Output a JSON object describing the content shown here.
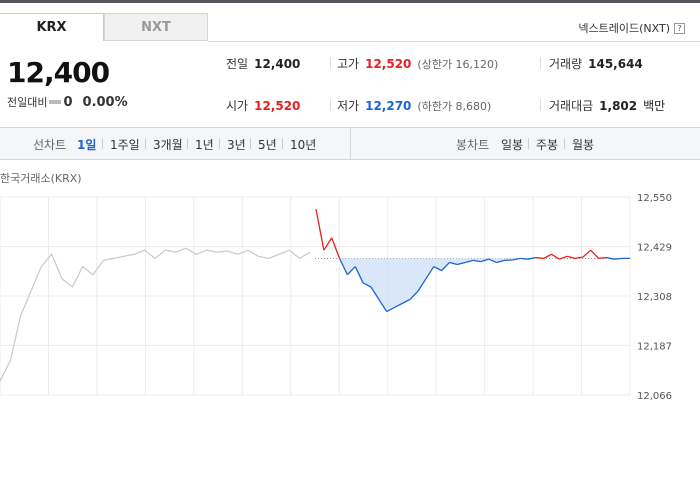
{
  "tabs": [
    {
      "label": "KRX",
      "active": true
    },
    {
      "label": "NXT",
      "active": false
    }
  ],
  "nextrade_link": "넥스트레이드(NXT)",
  "help_icon": "?",
  "quote": {
    "price": "12,400",
    "change_label": "전일대비",
    "change_value": "0",
    "change_pct": "0.00%"
  },
  "stats": {
    "prev_close": {
      "label": "전일",
      "value": "12,400"
    },
    "high": {
      "label": "고가",
      "value": "12,520",
      "limit_text": "(상한가 16,120)"
    },
    "volume": {
      "label": "거래량",
      "value": "145,644"
    },
    "open": {
      "label": "시가",
      "value": "12,520"
    },
    "low": {
      "label": "저가",
      "value": "12,270",
      "limit_text": "(하한가 8,680)"
    },
    "amount": {
      "label": "거래대금",
      "value": "1,802",
      "unit": "백만"
    }
  },
  "toolbar": {
    "line_label": "선차트",
    "line_periods": [
      "1일",
      "1주일",
      "3개월",
      "1년",
      "3년",
      "5년",
      "10년"
    ],
    "active_period": "1일",
    "candle_label": "봉차트",
    "candle_periods": [
      "일봉",
      "주봉",
      "월봉"
    ]
  },
  "exchange_label": "한국거래소(KRX)",
  "colors": {
    "up": "#e7201e",
    "down": "#1a64d6",
    "prev_day_line": "#c9c9c9"
  },
  "chart_data": {
    "type": "line",
    "ylabel": "",
    "y_ticks": [
      "12,550",
      "12,429",
      "12,308",
      "12,187",
      "12,066"
    ],
    "ylim": [
      12066,
      12550
    ],
    "baseline": 12400,
    "grid": true,
    "series": [
      {
        "role": "previous-day",
        "values": [
          12100,
          12150,
          12260,
          12320,
          12380,
          12410,
          12350,
          12330,
          12380,
          12360,
          12395,
          12400,
          12405,
          12410,
          12420,
          12400,
          12420,
          12415,
          12425,
          12410,
          12420,
          12415,
          12418,
          12410,
          12420,
          12405,
          12400,
          12410,
          12420,
          12400,
          12415
        ]
      },
      {
        "role": "today",
        "values": [
          12520,
          12420,
          12450,
          12400,
          12360,
          12380,
          12340,
          12330,
          12300,
          12270,
          12280,
          12290,
          12300,
          12320,
          12350,
          12380,
          12370,
          12390,
          12385,
          12390,
          12395,
          12392,
          12398,
          12390,
          12395,
          12396,
          12400,
          12398,
          12402,
          12400,
          12410,
          12398,
          12405,
          12400,
          12403,
          12420,
          12400,
          12402,
          12398,
          12400,
          12400
        ]
      }
    ]
  }
}
